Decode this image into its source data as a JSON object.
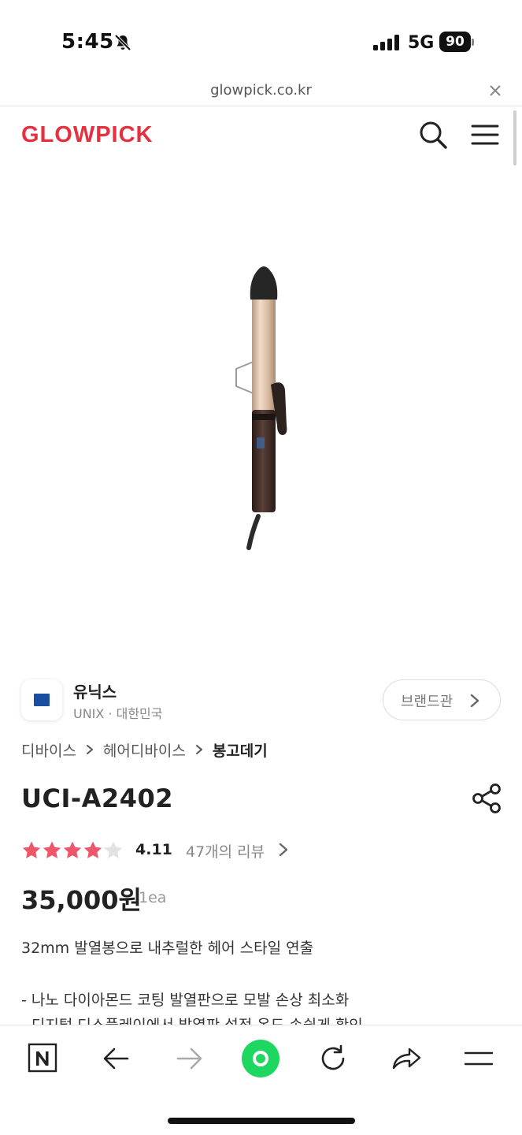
{
  "status_bar": {
    "time": "5:45",
    "network": "5G",
    "battery": "90"
  },
  "browser": {
    "url": "glowpick.co.kr"
  },
  "header": {
    "logo": "GLOWPICK"
  },
  "brand": {
    "name": "유닉스",
    "subtitle": "UNIX · 대한민국",
    "button_label": "브랜드관"
  },
  "breadcrumb": [
    "디바이스",
    "헤어디바이스",
    "봉고데기"
  ],
  "product": {
    "name": "UCI-A2402",
    "rating": "4.11",
    "rating_stars": 4.11,
    "review_link": "47개의 리뷰",
    "price": "35,000원",
    "unit": "1ea",
    "summary": "32mm 발열봉으로 내추럴한 헤어 스타일 연출",
    "features": [
      "- 나노 다이아몬드 코팅 발열판으로 모발 손상 최소화",
      "- 디지털 디스플레이에서 발열판 설정 온도 손쉽게 확인"
    ]
  },
  "colors": {
    "brand_red": "#e4303f",
    "star_pink": "#f0566a",
    "nav_green": "#1ed760"
  },
  "toolbar": {
    "icons": [
      "naver-n-icon",
      "back-arrow-icon",
      "forward-arrow-icon",
      "green-dot-icon",
      "refresh-icon",
      "share-icon",
      "menu-icon"
    ]
  }
}
